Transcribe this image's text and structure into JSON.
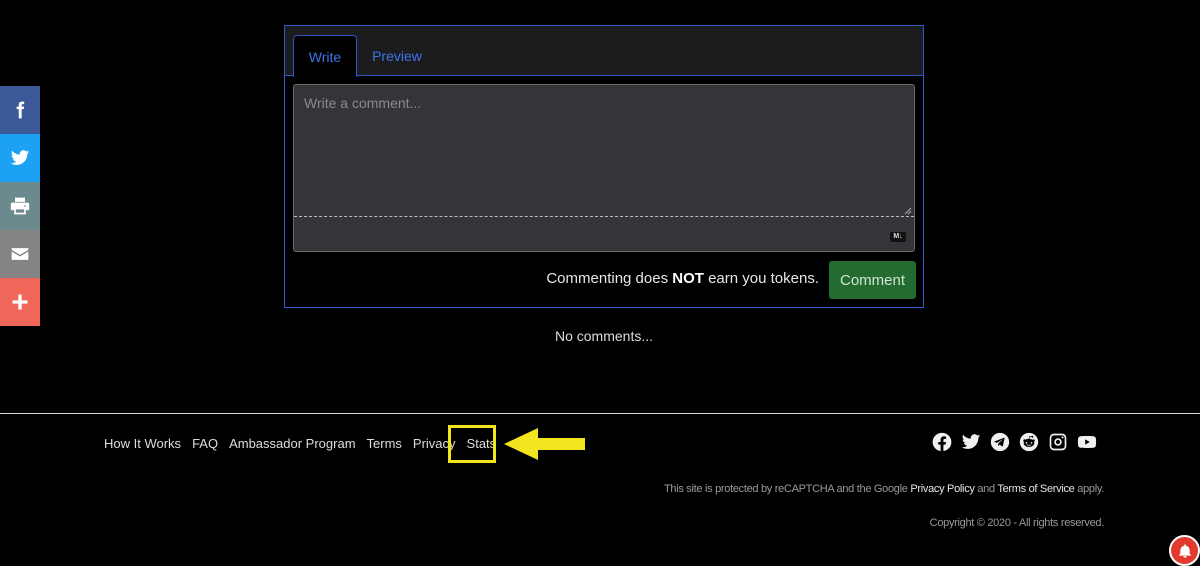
{
  "share": {
    "items": [
      {
        "name": "facebook",
        "icon": "facebook-icon",
        "color": "#3b5998"
      },
      {
        "name": "twitter",
        "icon": "twitter-icon",
        "color": "#1da1f2"
      },
      {
        "name": "print",
        "icon": "printer-icon",
        "color": "#6c8a8e"
      },
      {
        "name": "email",
        "icon": "envelope-icon",
        "color": "#848484"
      },
      {
        "name": "more",
        "icon": "plus-icon",
        "color": "#f0675a"
      }
    ]
  },
  "comment_box": {
    "tabs": {
      "write": "Write",
      "preview": "Preview"
    },
    "placeholder": "Write a comment...",
    "markdown_badge": "M↓",
    "note_prefix": "Commenting does ",
    "note_emphasis": "NOT",
    "note_suffix": " earn you tokens.",
    "submit_label": "Comment"
  },
  "comments": {
    "empty_text": "No comments..."
  },
  "footer": {
    "links": [
      "How It Works",
      "FAQ",
      "Ambassador Program",
      "Terms",
      "Privacy",
      "Stats"
    ],
    "social_icons": [
      "facebook-icon",
      "twitter-icon",
      "telegram-icon",
      "reddit-icon",
      "instagram-icon",
      "youtube-icon"
    ],
    "recaptcha": {
      "prefix": "This site is protected by reCAPTCHA and the Google ",
      "privacy": "Privacy Policy",
      "middle": " and ",
      "terms": "Terms of Service",
      "suffix": " apply."
    },
    "copyright": "Copyright © 2020 - All rights reserved."
  },
  "annotation": {
    "highlight_color": "#f2e51d"
  }
}
